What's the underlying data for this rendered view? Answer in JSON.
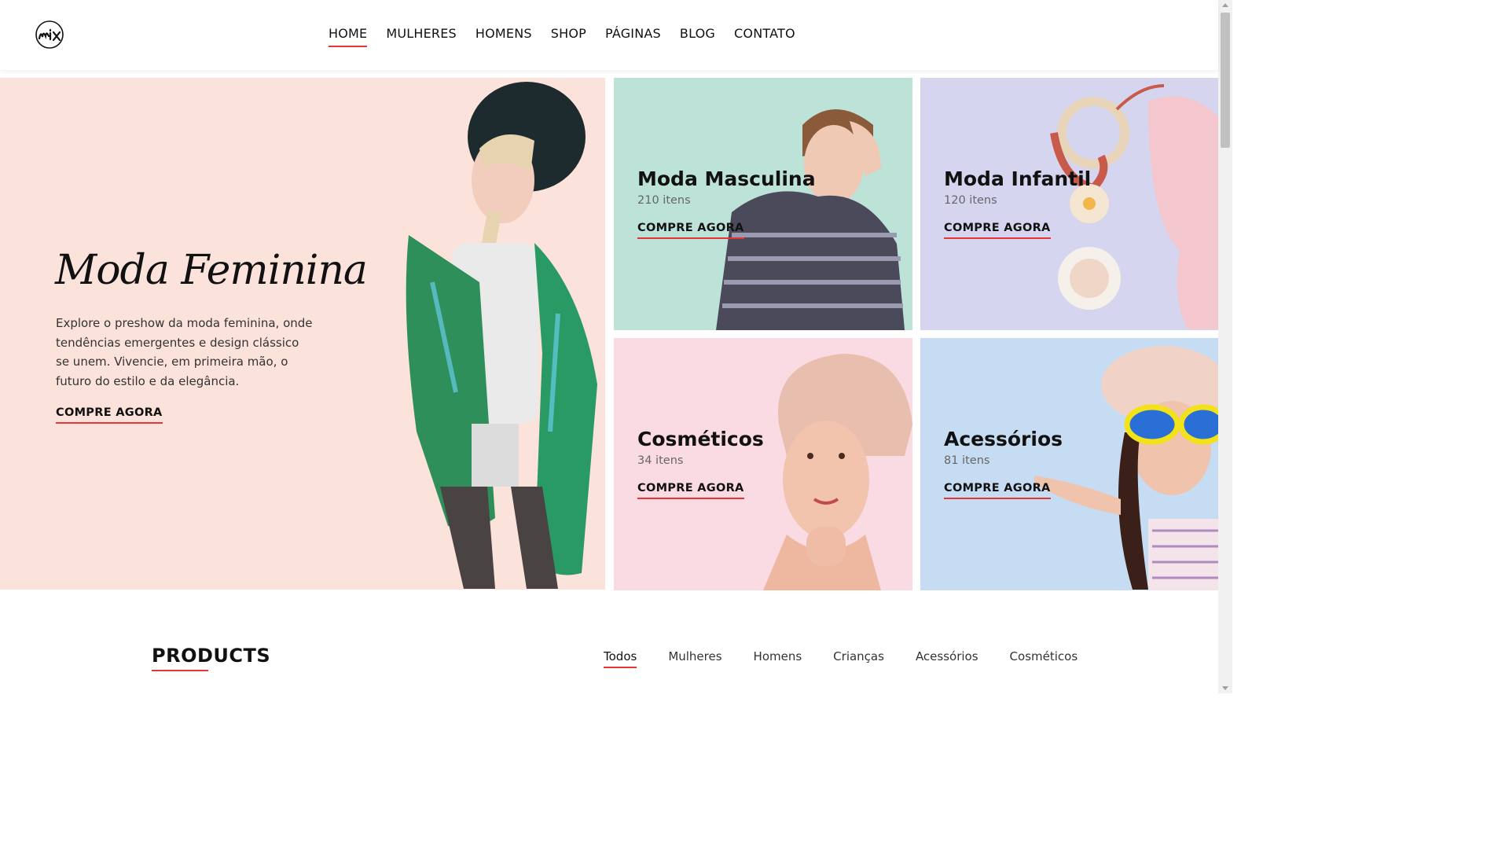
{
  "header": {
    "logo_text": "mix",
    "nav": [
      {
        "label": "HOME",
        "active": true
      },
      {
        "label": "MULHERES",
        "active": false
      },
      {
        "label": "HOMENS",
        "active": false
      },
      {
        "label": "SHOP",
        "active": false
      },
      {
        "label": "PÁGINAS",
        "active": false
      },
      {
        "label": "BLOG",
        "active": false
      },
      {
        "label": "CONTATO",
        "active": false
      }
    ]
  },
  "banner": {
    "main": {
      "title": "Moda Feminina",
      "description": "Explore o preshow da moda feminina, onde tendências emergentes e design clássico se unem. Vivencie, em primeira mão, o futuro do estilo e da elegância.",
      "cta": "COMPRE AGORA"
    },
    "cards": [
      {
        "title": "Moda Masculina",
        "count": "210 itens",
        "cta": "COMPRE AGORA"
      },
      {
        "title": "Moda Infantil",
        "count": "120 itens",
        "cta": "COMPRE AGORA"
      },
      {
        "title": "Cosméticos",
        "count": "34 itens",
        "cta": "COMPRE AGORA"
      },
      {
        "title": "Acessórios",
        "count": "81 itens",
        "cta": "COMPRE AGORA"
      }
    ]
  },
  "products": {
    "title": "PRODUCTS",
    "filters": [
      {
        "label": "Todos",
        "active": true
      },
      {
        "label": "Mulheres",
        "active": false
      },
      {
        "label": "Homens",
        "active": false
      },
      {
        "label": "Crianças",
        "active": false
      },
      {
        "label": "Acessórios",
        "active": false
      },
      {
        "label": "Cosméticos",
        "active": false
      }
    ]
  },
  "colors": {
    "accent": "#e53637",
    "banner_main_bg": "#fbe2da",
    "card_men_bg": "#bde3d8",
    "card_kids_bg": "#d6d5ef",
    "card_cosmetics_bg": "#fbdbe3",
    "card_accessories_bg": "#c6dcf3"
  }
}
